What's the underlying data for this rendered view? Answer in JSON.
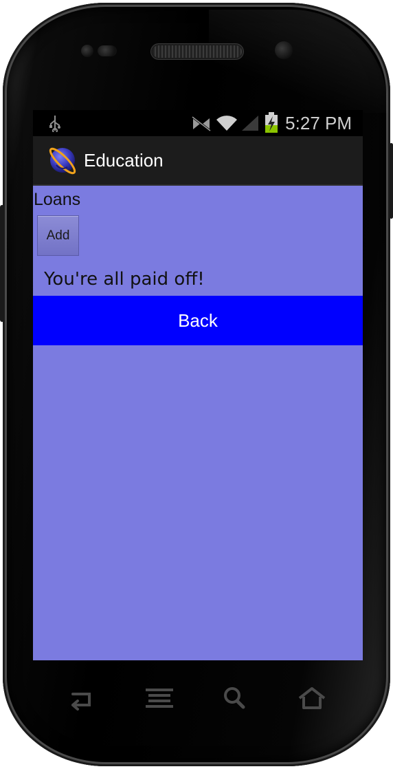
{
  "status_bar": {
    "time": "5:27 PM",
    "icons": [
      "usb-icon",
      "signal-muted-icon",
      "wifi-icon",
      "cell-signal-icon",
      "battery-charging-icon"
    ]
  },
  "action_bar": {
    "app_icon": "app-planet-icon",
    "title": "Education"
  },
  "content": {
    "section_label": "Loans",
    "add_button_label": "Add",
    "message": "You're all paid off!",
    "back_button_label": "Back"
  },
  "nav_bar": {
    "icons": [
      "back-icon",
      "menu-icon",
      "search-icon",
      "home-icon"
    ]
  },
  "colors": {
    "background": "#7b7be0",
    "back_button": "#0000ff",
    "action_bar": "#1c1c1c",
    "status_bar": "#000000"
  }
}
